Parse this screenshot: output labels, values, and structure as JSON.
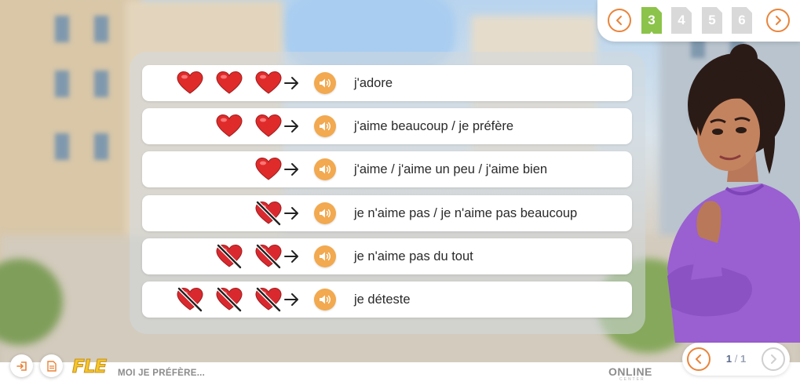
{
  "lesson": {
    "title": "MOI JE PRÉFÈRE...",
    "logo": "FLE"
  },
  "brand": {
    "name": "ONLINE",
    "tagline": "CENTER"
  },
  "pages": [
    {
      "label": "3",
      "active": true
    },
    {
      "label": "4",
      "active": false
    },
    {
      "label": "5",
      "active": false
    },
    {
      "label": "6",
      "active": false
    }
  ],
  "slide_counter": {
    "current": "1",
    "separator": "/",
    "total": "1"
  },
  "rows": [
    {
      "hearts": [
        "heart",
        "heart",
        "heart"
      ],
      "text": "j'adore"
    },
    {
      "hearts": [
        "heart",
        "heart"
      ],
      "text": "j'aime beaucoup / je préfère"
    },
    {
      "hearts": [
        "heart"
      ],
      "text": "j'aime / j'aime un peu / j'aime bien"
    },
    {
      "hearts": [
        "heart-crossed"
      ],
      "text": "je n'aime pas / je n'aime pas beaucoup"
    },
    {
      "hearts": [
        "heart-crossed",
        "heart-crossed"
      ],
      "text": "je n'aime pas du tout"
    },
    {
      "hearts": [
        "heart-crossed",
        "heart-crossed",
        "heart-crossed"
      ],
      "text": "je déteste"
    }
  ],
  "icons": {
    "heart": "heart-icon",
    "crossed": "crossed-heart-icon",
    "arrow": "arrow-right-icon",
    "audio": "speaker-icon",
    "prev": "chevron-left-icon",
    "next": "chevron-right-icon",
    "exit": "exit-icon",
    "doc": "document-icon"
  },
  "colors": {
    "accent": "#e9843a",
    "audio_button": "#f2a94f",
    "heart": "#e02b2b",
    "active_page": "#8cc34a",
    "inactive_page": "#d9d9d9"
  }
}
